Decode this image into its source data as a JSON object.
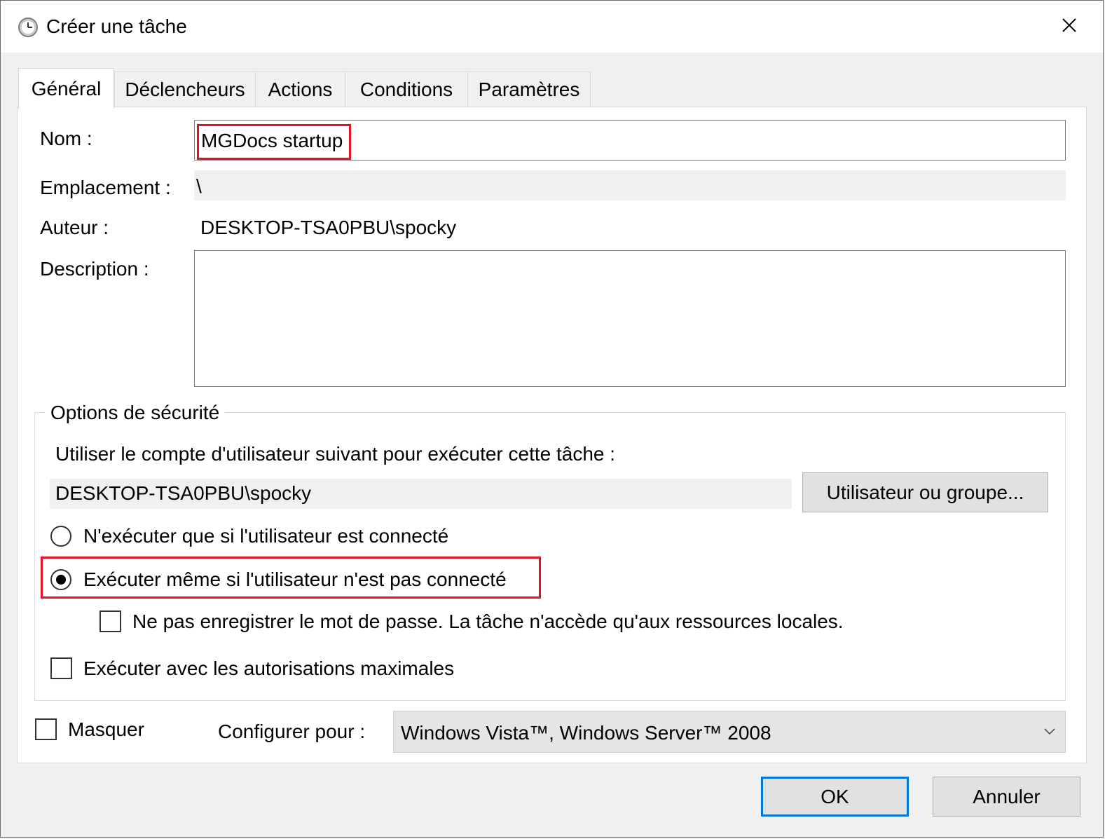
{
  "window": {
    "title": "Créer une tâche"
  },
  "tabs": [
    {
      "label": "Général"
    },
    {
      "label": "Déclencheurs"
    },
    {
      "label": "Actions"
    },
    {
      "label": "Conditions"
    },
    {
      "label": "Paramètres"
    }
  ],
  "general": {
    "name_label": "Nom :",
    "name_value": "MGDocs startup",
    "location_label": "Emplacement :",
    "location_value": "\\",
    "author_label": "Auteur :",
    "author_value": "DESKTOP-TSA0PBU\\spocky",
    "description_label": "Description :",
    "description_value": ""
  },
  "security": {
    "group_title": "Options de sécurité",
    "account_prompt": "Utiliser le compte d'utilisateur suivant pour exécuter cette tâche :",
    "account_value": "DESKTOP-TSA0PBU\\spocky",
    "user_group_button": "Utilisateur ou groupe...",
    "radio_logged_on": "N'exécuter que si l'utilisateur est connecté",
    "radio_logged_on_selected": false,
    "radio_whether_logged": "Exécuter même si l'utilisateur n'est pas connecté",
    "radio_whether_logged_selected": true,
    "no_store_password": "Ne pas enregistrer le mot de passe. La tâche n'accède qu'aux ressources locales.",
    "no_store_password_checked": false,
    "highest_privileges": "Exécuter avec les autorisations maximales",
    "highest_privileges_checked": false
  },
  "footer_options": {
    "hidden_label": "Masquer",
    "hidden_checked": false,
    "configure_label": "Configurer pour :",
    "configure_value": "Windows Vista™, Windows Server™ 2008"
  },
  "buttons": {
    "ok": "OK",
    "cancel": "Annuler"
  },
  "colors": {
    "highlight": "#e81123",
    "focus": "#0078d7"
  }
}
